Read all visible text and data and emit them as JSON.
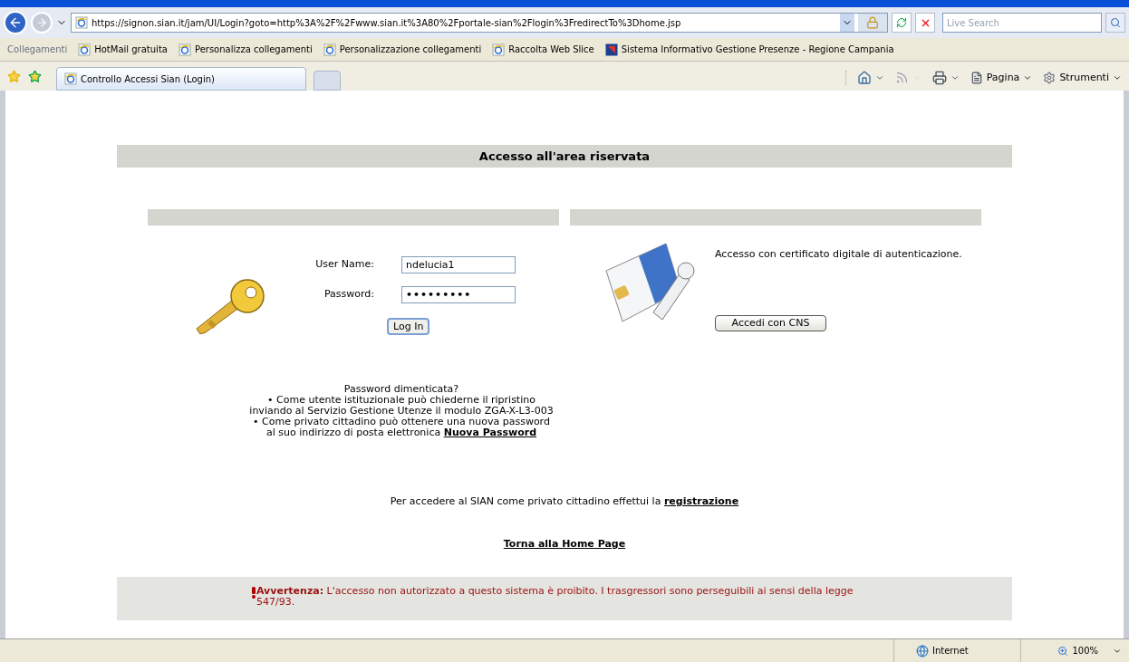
{
  "address_bar": {
    "url": "https://signon.sian.it/jam/UI/Login?goto=http%3A%2F%2Fwww.sian.it%3A80%2Fportale-sian%2Flogin%3FredirectTo%3Dhome.jsp",
    "search_placeholder": "Live Search"
  },
  "links_bar": {
    "label": "Collegamenti",
    "items": [
      {
        "label": "HotMail gratuita",
        "kind": "ie"
      },
      {
        "label": "Personalizza collegamenti",
        "kind": "ie"
      },
      {
        "label": "Personalizzazione collegamenti",
        "kind": "ie"
      },
      {
        "label": "Raccolta Web Slice",
        "kind": "ie"
      },
      {
        "label": "Sistema Informativo Gestione Presenze - Regione Campania",
        "kind": "site"
      }
    ]
  },
  "tabs": [
    {
      "label": "Controllo Accessi Sian (Login)",
      "selected": true
    }
  ],
  "command_bar": {
    "items": [
      {
        "kind": "home"
      },
      {
        "kind": "feeds"
      },
      {
        "kind": "print"
      },
      {
        "kind": "page",
        "label": "Pagina"
      },
      {
        "kind": "tools",
        "label": "Strumenti"
      }
    ]
  },
  "page": {
    "title": "Accesso all'area riservata",
    "login": {
      "fields": [
        {
          "label": "User Name:",
          "value": "ndelucia1",
          "kind": "text"
        },
        {
          "label": "Password:",
          "value": "•••••••••",
          "kind": "password"
        }
      ],
      "button": "Log In"
    },
    "certificate": {
      "text": "Accesso con certificato digitale di autenticazione.",
      "button": "Accedi con CNS"
    },
    "forgot": {
      "title": "Password dimenticata?",
      "items": [
        {
          "bullet": "•",
          "text": "Come utente istituzionale può chiederne il ripristino inviando al Servizio Gestione Utenze il modulo ZGA-X-L3-003"
        },
        {
          "bullet": "•",
          "text": "Come privato cittadino può ottenere una nuova password al suo indirizzo di posta elettronica",
          "link": "Nuova Password"
        }
      ]
    },
    "registration": {
      "text": "Per accedere al SIAN come privato cittadino effettui la",
      "link": "registrazione"
    },
    "home_link": "Torna alla Home Page",
    "warning": "**Avvertenza:** L'accesso non autorizzato a questo sistema è proibito. I trasgressori sono perseguibili ai sensi della legge 547/93."
  },
  "status_bar": {
    "zone": "Internet",
    "zoom": "100%"
  }
}
